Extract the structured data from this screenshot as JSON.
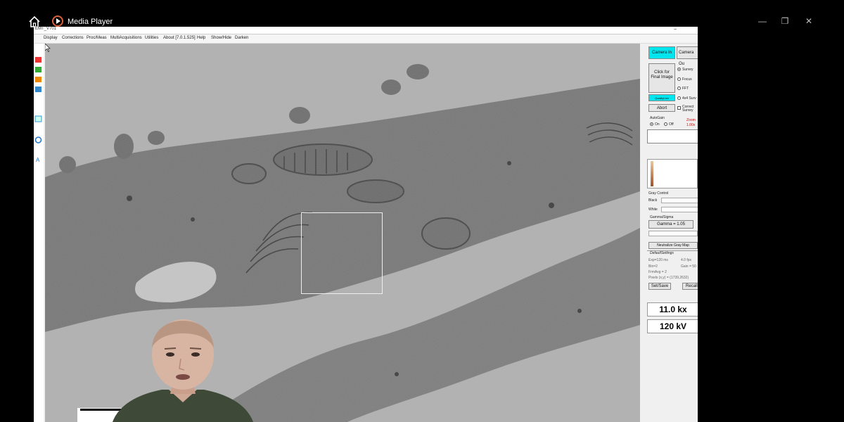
{
  "window": {
    "title": "Media Player",
    "minimize_glyph": "—",
    "maximize_glyph": "❐",
    "close_glyph": "✕"
  },
  "app": {
    "title": "EMT_V701",
    "menu": [
      "Display",
      "Corrections",
      "Proc/Meas",
      "MultiAcquisitions",
      "Utilities",
      "About [7.0.1.525]",
      "Help",
      "Show/Hide",
      "Darken"
    ]
  },
  "image": {
    "scale_label": "500"
  },
  "panel": {
    "camera_in": "Camera In",
    "camera_out": "Camera Ou",
    "click_final": "Click for Final Image",
    "modes": [
      "Survey",
      "Focus",
      "FFT",
      "4x4 Surv"
    ],
    "quality_live": "QualityLive",
    "abort": "Abort",
    "correct": "Correct Survey",
    "autogain": "AutoGain",
    "on": "On",
    "off": "Off",
    "zoom": "Zoom",
    "zoom_value": "1.00x",
    "gray_control": "Gray Control",
    "black": "Black",
    "white": "White",
    "gamma_sigma": "Gamma/Sigma",
    "gamma_value": "Gamma = 1.05",
    "neutralize": "Neutralize Gray Map",
    "default_settings": "DefaultSettings",
    "exp": "Exp=120 ms",
    "fps": "4.0 fps",
    "bin": "Bin=2",
    "gain": "Gain = 50",
    "frmavg": "FrmAvg = 2",
    "pixels": "Pixels (x,y) = (1739,2632)",
    "set_save": "Set/Save",
    "recall": "Recall",
    "magnification": "11.0 kx",
    "voltage": "120 kV"
  },
  "colors": {
    "accent_cyan": "#00e5ee",
    "zoom_red": "#dd0000"
  }
}
